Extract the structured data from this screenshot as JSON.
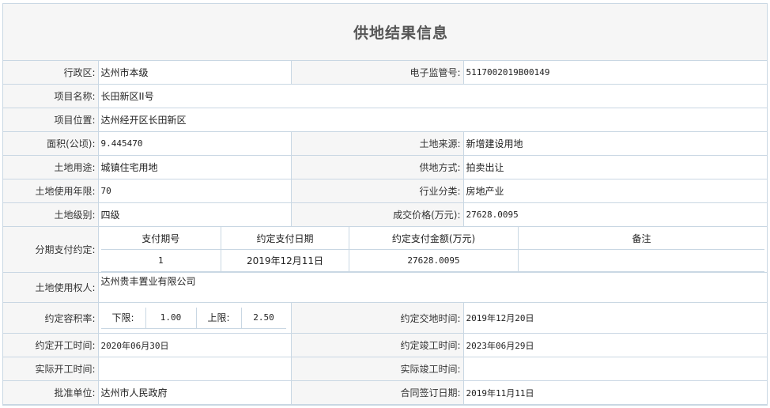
{
  "page": {
    "title": "供地结果信息"
  },
  "fields": {
    "district_label": "行政区:",
    "district_value": "达州市本级",
    "supervision_no_label": "电子监管号:",
    "supervision_no_value": "5117002019B00149",
    "project_name_label": "项目名称:",
    "project_name_value": "长田新区II号",
    "project_location_label": "项目位置:",
    "project_location_value": "达州经开区长田新区",
    "area_label": "面积(公顷):",
    "area_value": "9.445470",
    "land_source_label": "土地来源:",
    "land_source_value": "新增建设用地",
    "land_use_label": "土地用途:",
    "land_use_value": "城镇住宅用地",
    "supply_method_label": "供地方式:",
    "supply_method_value": "拍卖出让",
    "use_term_label": "土地使用年限:",
    "use_term_value": "70",
    "industry_label": "行业分类:",
    "industry_value": "房地产业",
    "land_grade_label": "土地级别:",
    "land_grade_value": "四级",
    "deal_price_label": "成交价格(万元):",
    "deal_price_value": "27628.0095",
    "installment_label": "分期支付约定:",
    "owner_label": "土地使用权人:",
    "owner_value": "达州贵丰置业有限公司",
    "far_label": "约定容积率:",
    "far_lower_label": "下限:",
    "far_lower_value": "1.00",
    "far_upper_label": "上限:",
    "far_upper_value": "2.50",
    "handover_label": "约定交地时间:",
    "handover_value": "2019年12月20日",
    "start_label": "约定开工时间:",
    "start_value": "2020年06月30日",
    "complete_label": "约定竣工时间:",
    "complete_value": "2023年06月29日",
    "actual_start_label": "实际开工时间:",
    "actual_start_value": "",
    "actual_complete_label": "实际竣工时间:",
    "actual_complete_value": "",
    "approver_label": "批准单位:",
    "approver_value": "达州市人民政府",
    "contract_date_label": "合同签订日期:",
    "contract_date_value": "2019年11月11日"
  },
  "installments": {
    "headers": [
      "支付期号",
      "约定支付日期",
      "约定支付金额(万元)",
      "备注"
    ],
    "rows": [
      [
        "1",
        "2019年12月11日",
        "27628.0095",
        ""
      ]
    ]
  }
}
